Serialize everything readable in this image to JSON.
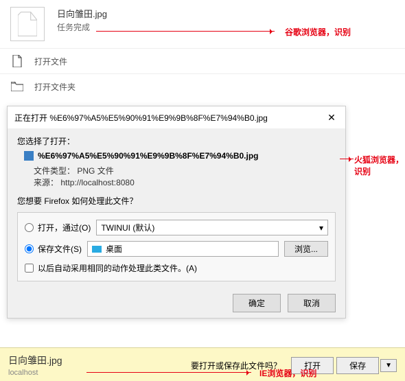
{
  "chrome": {
    "filename": "日向雏田.jpg",
    "status": "任务完成",
    "actions": {
      "open_file": "打开文件",
      "open_folder": "打开文件夹"
    }
  },
  "firefox": {
    "titlebar": "正在打开  %E6%97%A5%E5%90%91%E9%9B%8F%E7%94%B0.jpg",
    "prompt": "您选择了打开：",
    "filename": "%E6%97%A5%E5%90%91%E9%9B%8F%E7%94%B0.jpg",
    "filetype_label": "文件类型：",
    "filetype_value": "PNG 文件",
    "source_label": "来源：",
    "source_value": "http://localhost:8080",
    "question": "您想要 Firefox 如何处理此文件？",
    "open_with_label": "打开，通过(O)",
    "open_with_app": "TWINUI (默认)",
    "save_label": "保存文件(S)",
    "save_target": "桌面",
    "browse_btn": "浏览...",
    "remember_label": "以后自动采用相同的动作处理此类文件。(A)",
    "ok_btn": "确定",
    "cancel_btn": "取消"
  },
  "ie": {
    "filename": "日向雏田.jpg",
    "source": "localhost",
    "prompt": "要打开或保存此文件吗？",
    "open_btn": "打开",
    "save_btn": "保存"
  },
  "annotations": {
    "chrome": "谷歌浏览器，识别",
    "firefox": "火狐浏览器，识别",
    "ie": "IE浏览器，识别"
  }
}
